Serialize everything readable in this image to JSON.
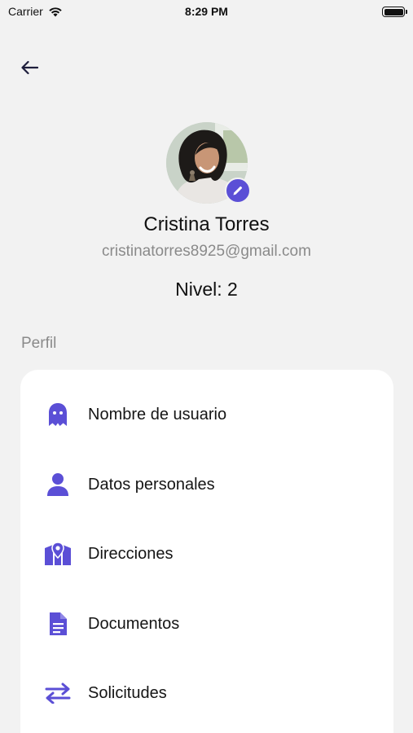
{
  "status_bar": {
    "carrier": "Carrier",
    "time": "8:29 PM"
  },
  "profile": {
    "name": "Cristina Torres",
    "email": "cristinatorres8925@gmail.com",
    "level": "Nivel: 2"
  },
  "section": {
    "title": "Perfil"
  },
  "menu": {
    "items": [
      {
        "label": "Nombre de usuario",
        "icon": "ghost-icon"
      },
      {
        "label": "Datos personales",
        "icon": "person-icon"
      },
      {
        "label": "Direcciones",
        "icon": "map-marker-icon"
      },
      {
        "label": "Documentos",
        "icon": "document-icon"
      },
      {
        "label": "Solicitudes",
        "icon": "swap-arrows-icon"
      }
    ]
  },
  "colors": {
    "accent": "#5b4fd6",
    "background": "#f2f2f2",
    "card": "#ffffff",
    "muted_text": "#8a8a8a"
  }
}
